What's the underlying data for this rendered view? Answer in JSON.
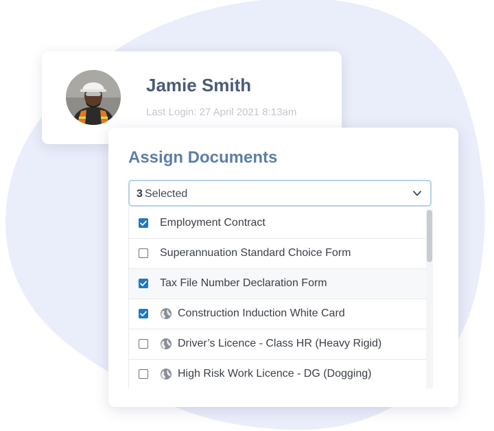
{
  "profile": {
    "name": "Jamie Smith",
    "last_login": "Last Login: 27 April 2021 8:13am"
  },
  "documents": {
    "title": "Assign Documents",
    "select": {
      "count": "3",
      "label": "Selected"
    },
    "items": [
      {
        "label": "Employment Contract",
        "checked": true,
        "globe": false
      },
      {
        "label": "Superannuation Standard Choice Form",
        "checked": false,
        "globe": false
      },
      {
        "label": "Tax File Number Declaration Form",
        "checked": true,
        "globe": false
      },
      {
        "label": "Construction Induction White Card",
        "checked": true,
        "globe": true
      },
      {
        "label": "Driver’s Licence - Class HR (Heavy Rigid)",
        "checked": false,
        "globe": true
      },
      {
        "label": "High Risk Work Licence - DG (Dogging)",
        "checked": false,
        "globe": true
      }
    ]
  },
  "colors": {
    "background_blob": "#eaedfa",
    "checkbox_checked": "#1e78c2",
    "title": "#5d7fa3",
    "name": "#4a5b76"
  },
  "icons": {
    "checked": "checkbox-checked-icon",
    "unchecked": "checkbox-unchecked-icon",
    "globe": "globe-icon",
    "dropdown": "chevron-down-icon"
  }
}
